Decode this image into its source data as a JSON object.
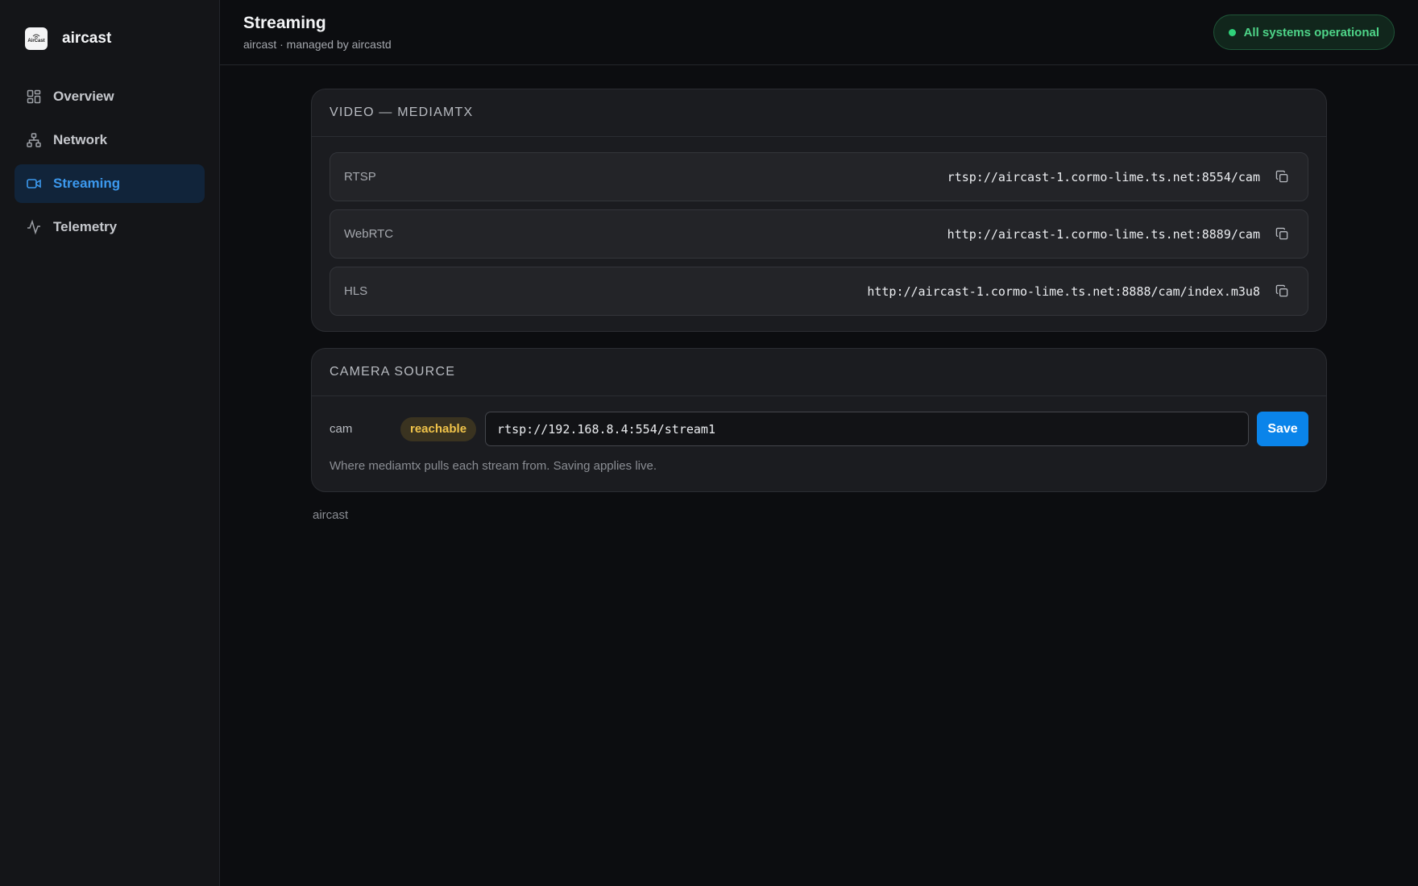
{
  "app": {
    "name": "aircast",
    "logo_text": "AirCast"
  },
  "sidebar": {
    "items": [
      {
        "label": "Overview",
        "icon": "grid-icon",
        "active": false
      },
      {
        "label": "Network",
        "icon": "network-icon",
        "active": false
      },
      {
        "label": "Streaming",
        "icon": "video-camera-icon",
        "active": true
      },
      {
        "label": "Telemetry",
        "icon": "activity-icon",
        "active": false
      }
    ]
  },
  "header": {
    "title": "Streaming",
    "subtitle": "aircast · managed by aircastd",
    "status": "All systems operational"
  },
  "video": {
    "title": "VIDEO — MEDIAMTX",
    "rows": [
      {
        "label": "RTSP",
        "url": "rtsp://aircast-1.cormo-lime.ts.net:8554/cam"
      },
      {
        "label": "WebRTC",
        "url": "http://aircast-1.cormo-lime.ts.net:8889/cam"
      },
      {
        "label": "HLS",
        "url": "http://aircast-1.cormo-lime.ts.net:8888/cam/index.m3u8"
      }
    ]
  },
  "camera": {
    "title": "CAMERA SOURCE",
    "name": "cam",
    "status": "reachable",
    "source_value": "rtsp://192.168.8.4:554/stream1",
    "save_label": "Save",
    "hint": "Where mediamtx pulls each stream from. Saving applies live."
  },
  "footer": {
    "text": "aircast"
  },
  "colors": {
    "accent": "#0a84ea",
    "active_nav": "#3c99ee",
    "status_ok": "#2fd27a",
    "badge_warn": "#f0c34a"
  }
}
